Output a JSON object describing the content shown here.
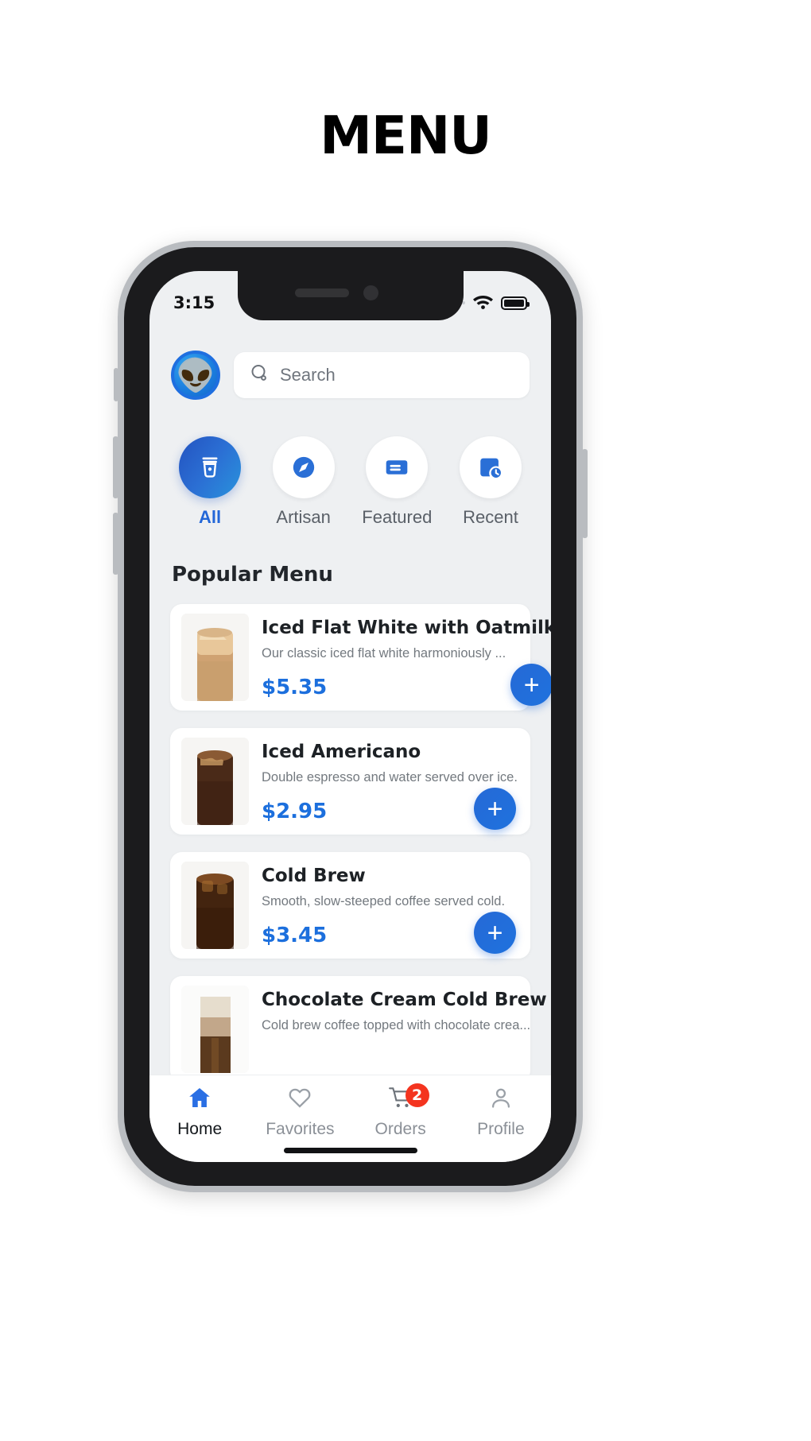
{
  "page": {
    "title": "MENU"
  },
  "status_bar": {
    "time": "3:15",
    "signal_icon": "signal-dots-icon",
    "wifi_icon": "wifi-icon",
    "battery_icon": "battery-full-icon"
  },
  "header": {
    "avatar_icon": "astronaut-avatar",
    "search": {
      "placeholder": "Search",
      "value": "",
      "icon": "search-icon"
    }
  },
  "categories": [
    {
      "label": "All",
      "icon": "coffee-cup-icon",
      "active": true
    },
    {
      "label": "Artisan",
      "icon": "compass-icon",
      "active": false
    },
    {
      "label": "Featured",
      "icon": "card-icon",
      "active": false
    },
    {
      "label": "Recent",
      "icon": "history-clock-icon",
      "active": false
    }
  ],
  "section": {
    "title": "Popular Menu"
  },
  "menu_items": [
    {
      "name": "Iced Flat White with Oatmilk",
      "description": "Our classic iced flat white harmoniously ...",
      "price": "$5.35",
      "add_label": "+",
      "thumb": "iced-flat-white-photo"
    },
    {
      "name": "Iced Americano",
      "description": "Double espresso and water served over ice.",
      "price": "$2.95",
      "add_label": "+",
      "thumb": "iced-americano-photo"
    },
    {
      "name": "Cold Brew",
      "description": "Smooth, slow-steeped coffee served cold.",
      "price": "$3.45",
      "add_label": "+",
      "thumb": "cold-brew-photo"
    },
    {
      "name": "Chocolate Cream Cold Brew",
      "description": "Cold brew coffee topped with chocolate crea...",
      "price": "",
      "add_label": "+",
      "thumb": "chocolate-cream-cold-brew-photo"
    }
  ],
  "bottom_nav": [
    {
      "label": "Home",
      "icon": "home-icon",
      "active": true,
      "badge": ""
    },
    {
      "label": "Favorites",
      "icon": "heart-icon",
      "active": false,
      "badge": ""
    },
    {
      "label": "Orders",
      "icon": "cart-icon",
      "active": false,
      "badge": "2"
    },
    {
      "label": "Profile",
      "icon": "person-icon",
      "active": false,
      "badge": ""
    }
  ],
  "colors": {
    "accent": "#1c6fdd",
    "accent_dark": "#2353c0",
    "badge": "#f4341f",
    "screen_bg": "#eef0f2",
    "card_bg": "#ffffff",
    "text_primary": "#1d2125",
    "text_muted": "#73797f"
  }
}
